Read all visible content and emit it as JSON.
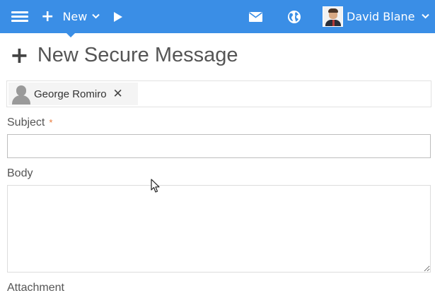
{
  "header": {
    "new_label": "New",
    "user_name": "David Blane",
    "accent_color": "#3a8ee6",
    "icons": [
      "menu-icon",
      "plus-icon",
      "chevron-down-icon",
      "play-icon",
      "mail-icon",
      "globe-icon",
      "avatar",
      "chevron-down-icon"
    ]
  },
  "page": {
    "title": "New Secure Message"
  },
  "recipients": [
    {
      "name": "George Romiro"
    }
  ],
  "form": {
    "subject_label": "Subject",
    "subject_required_mark": "*",
    "subject_value": "",
    "body_label": "Body",
    "body_value": "",
    "attachment_label": "Attachment"
  }
}
